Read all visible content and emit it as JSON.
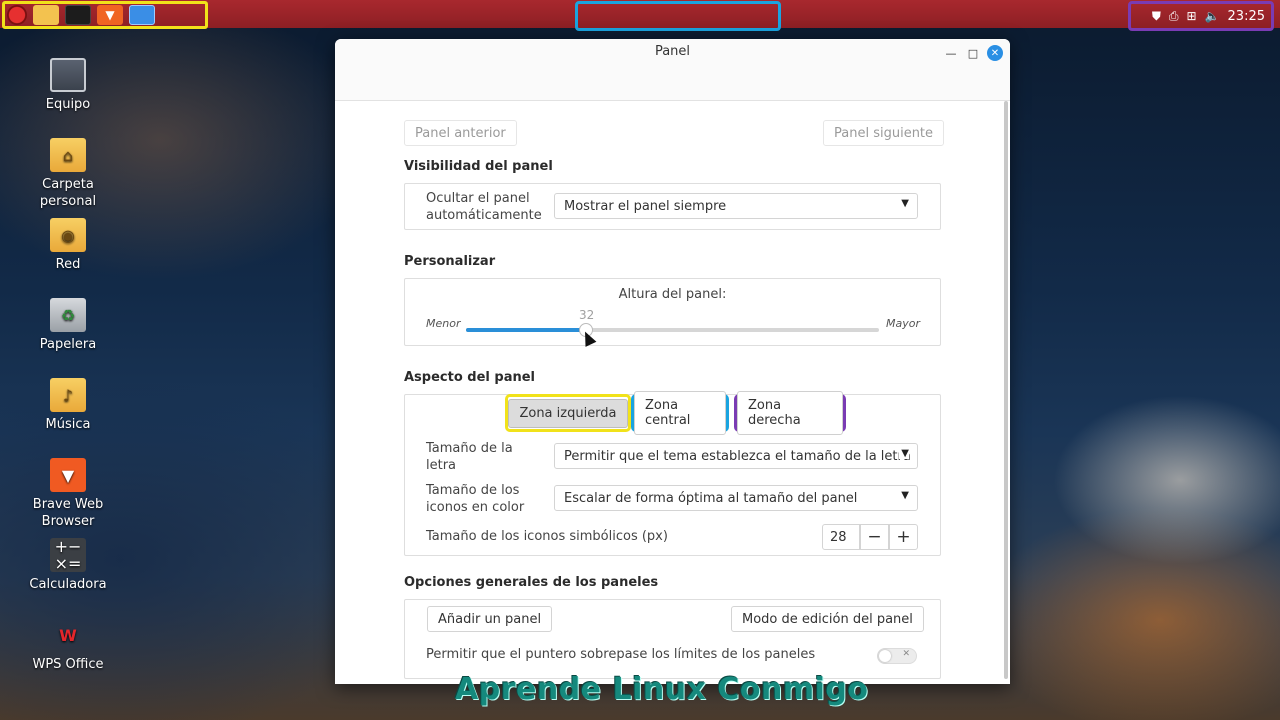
{
  "taskbar": {
    "launchers": [
      "menu-icon",
      "folder-icon",
      "terminal-icon",
      "brave-icon",
      "files-icon"
    ],
    "clock": "23:25",
    "tray_icons": [
      "shield-icon",
      "printer-icon",
      "network-icon",
      "volume-icon"
    ]
  },
  "desktop": {
    "icons": [
      {
        "label": "Equipo",
        "icon": "monitor-icon"
      },
      {
        "label": "Carpeta\npersonal",
        "icon": "home-folder-icon"
      },
      {
        "label": "Red",
        "icon": "network-folder-icon"
      },
      {
        "label": "Papelera",
        "icon": "trash-icon"
      },
      {
        "label": "Música",
        "icon": "music-folder-icon"
      },
      {
        "label": "Brave Web\nBrowser",
        "icon": "brave-icon"
      },
      {
        "label": "Calculadora",
        "icon": "calculator-icon"
      },
      {
        "label": "WPS Office",
        "icon": "wps-icon"
      }
    ]
  },
  "window": {
    "title": "Panel",
    "nav": {
      "prev": "Panel anterior",
      "next": "Panel siguiente"
    },
    "visibility": {
      "section": "Visibilidad del panel",
      "autohide_label": "Ocultar el panel\nautomáticamente",
      "autohide_value": "Mostrar el panel siempre"
    },
    "customize": {
      "section": "Personalizar",
      "height_label": "Altura del panel:",
      "min_label": "Menor",
      "max_label": "Mayor",
      "height_value": "32",
      "height_fraction": 0.29
    },
    "appearance": {
      "section": "Aspecto del panel",
      "zones": [
        "Zona izquierda",
        "Zona central",
        "Zona derecha"
      ],
      "font_size_label": "Tamaño de la\nletra",
      "font_size_value": "Permitir que el tema establezca el tamaño de la letra",
      "color_icons_label": "Tamaño de los\niconos en color",
      "color_icons_value": "Escalar de forma óptima al tamaño del panel",
      "symbolic_label": "Tamaño de los iconos simbólicos (px)",
      "symbolic_value": "28",
      "minus": "−",
      "plus": "+"
    },
    "general": {
      "section": "Opciones generales de los paneles",
      "add_panel": "Añadir un panel",
      "edit_mode": "Modo de edición del panel",
      "pointer_label": "Permitir que el puntero sobrepase los límites de los paneles",
      "pointer_enabled": false
    }
  },
  "watermark": "Aprende Linux Conmigo"
}
